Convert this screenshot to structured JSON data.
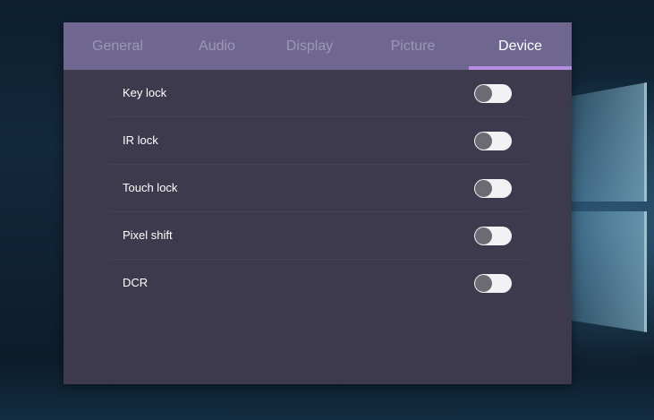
{
  "tabs": [
    {
      "label": "General",
      "active": false
    },
    {
      "label": "Audio",
      "active": false
    },
    {
      "label": "Display",
      "active": false
    },
    {
      "label": "Picture",
      "active": false
    },
    {
      "label": "Device",
      "active": true
    }
  ],
  "settings": [
    {
      "label": "Key lock",
      "enabled": false
    },
    {
      "label": "IR lock",
      "enabled": false
    },
    {
      "label": "Touch lock",
      "enabled": false
    },
    {
      "label": "Pixel shift",
      "enabled": false
    },
    {
      "label": "DCR",
      "enabled": false
    }
  ],
  "colors": {
    "panel_bg": "#3d3a4d",
    "tabbar_bg": "#6f6790",
    "active_underline": "#b58ee2",
    "inactive_tab_text": "#9d97b4",
    "toggle_track": "#f2f2f4",
    "toggle_knob": "#6c6a73"
  }
}
